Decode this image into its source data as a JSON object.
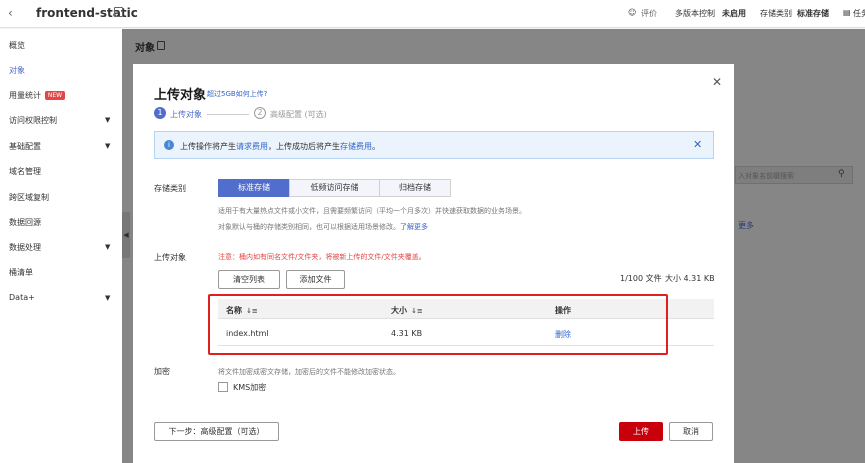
{
  "topbar": {
    "back_icon": "chevron-left-icon",
    "title": "frontend-static",
    "eval": "评价",
    "multi_version": "多版本控制",
    "multi_version_state": "未启用",
    "storage_class_label": "存储类别",
    "storage_class_value": "标准存储",
    "task": "任务"
  },
  "sidebar": {
    "items": [
      {
        "label": "概览",
        "arrow": false
      },
      {
        "label": "对象",
        "arrow": false,
        "active": true
      },
      {
        "label": "用量统计",
        "badge": "NEW",
        "arrow": false
      },
      {
        "label": "访问权限控制",
        "arrow": true
      },
      {
        "label": "基础配置",
        "arrow": true
      },
      {
        "label": "域名管理",
        "arrow": false
      },
      {
        "label": "跨区域复制",
        "arrow": false
      },
      {
        "label": "数据回源",
        "arrow": false
      },
      {
        "label": "数据处理",
        "arrow": true
      },
      {
        "label": "桶清单",
        "arrow": false
      },
      {
        "label": "Data+",
        "arrow": true
      }
    ]
  },
  "main": {
    "breadcrumb": "对象",
    "search_placeholder": "入对象名前缀搜索",
    "more": "更多"
  },
  "modal": {
    "title": "上传对象",
    "title_link": "超过5GB如何上传?",
    "steps": [
      {
        "num": "1",
        "label": "上传对象"
      },
      {
        "num": "2",
        "label": "高级配置 (可选)"
      }
    ],
    "info": {
      "t1": "上传操作将产生",
      "l1": "请求费用",
      "t2": "，上传成功后将产生",
      "l2": "存储费用",
      "t3": "。"
    },
    "storage_class": {
      "label": "存储类别",
      "options": [
        "标准存储",
        "低频访问存储",
        "归档存储"
      ],
      "selected": "标准存储",
      "hint1": "适用于有大量热点文件或小文件，且需要频繁访问（平均一个月多次）并快速获取数据的业务场景。",
      "hint2": "对象默认与桶的存储类别相同，也可以根据适用场景修改。",
      "hint2_link": "了解更多"
    },
    "upload": {
      "label": "上传对象",
      "warning": "注意：桶内如有同名文件/文件夹，将被新上传的文件/文件夹覆盖。",
      "clear_btn": "清空列表",
      "add_btn": "添加文件",
      "count": "1/100 文件",
      "size": "大小 4.31 KB",
      "columns": [
        "名称",
        "大小",
        "操作"
      ],
      "rows": [
        {
          "name": "index.html",
          "size": "4.31 KB",
          "action": "删除"
        }
      ]
    },
    "encryption": {
      "label": "加密",
      "hint": "将文件加密成密文存储，加密后的文件不能修改加密状态。",
      "kms_label": "KMS加密",
      "kms_checked": false
    },
    "footer": {
      "next_btn": "下一步：高级配置（可选）",
      "upload_btn": "上传",
      "cancel_btn": "取消"
    }
  },
  "colors": {
    "accent": "#526ecc",
    "upload_red": "#c7000b",
    "highlight_box": "#e02020",
    "warning_text": "#e54545"
  }
}
